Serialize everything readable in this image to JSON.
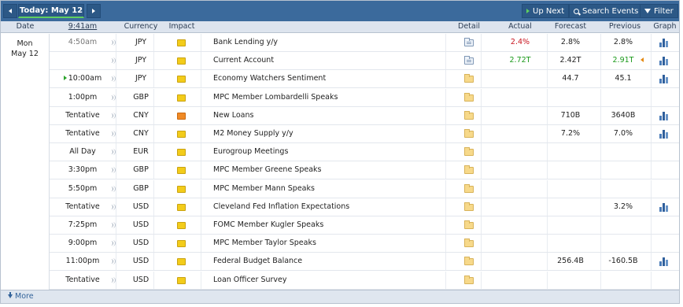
{
  "toolbar": {
    "today_label": "Today: May 12",
    "up_next_label": "Up Next",
    "search_label": "Search Events",
    "filter_label": "Filter"
  },
  "columns": {
    "date": "Date",
    "time": "9:41am",
    "currency": "Currency",
    "impact": "Impact",
    "detail": "Detail",
    "actual": "Actual",
    "forecast": "Forecast",
    "previous": "Previous",
    "graph": "Graph"
  },
  "date_cell": {
    "weekday": "Mon",
    "date": "May 12"
  },
  "events": [
    {
      "time": "4:50am",
      "currency": "JPY",
      "impact": "low",
      "event": "Bank Lending y/y",
      "detail_icon": "doc-folder-icon",
      "actual": "2.4%",
      "actual_color": "red",
      "forecast": "2.8%",
      "previous": "2.8%",
      "graph": true
    },
    {
      "time": "",
      "currency": "JPY",
      "impact": "low",
      "event": "Current Account",
      "detail_icon": "doc-folder-icon",
      "actual": "2.72T",
      "actual_color": "green",
      "forecast": "2.42T",
      "previous": "2.91T",
      "previous_color": "green",
      "revised": true,
      "graph": true
    },
    {
      "time": "10:00am",
      "upcoming": true,
      "currency": "JPY",
      "impact": "low",
      "event": "Economy Watchers Sentiment",
      "detail_icon": "folder-icon",
      "actual": "",
      "forecast": "44.7",
      "previous": "45.1",
      "graph": true
    },
    {
      "time": "1:00pm",
      "currency": "GBP",
      "impact": "low",
      "event": "MPC Member Lombardelli Speaks",
      "detail_icon": "folder-icon",
      "actual": "",
      "forecast": "",
      "previous": "",
      "graph": false
    },
    {
      "time": "Tentative",
      "currency": "CNY",
      "impact": "medium",
      "event": "New Loans",
      "detail_icon": "folder-icon",
      "actual": "",
      "forecast": "710B",
      "previous": "3640B",
      "graph": true
    },
    {
      "time": "Tentative",
      "currency": "CNY",
      "impact": "low",
      "event": "M2 Money Supply y/y",
      "detail_icon": "folder-icon",
      "actual": "",
      "forecast": "7.2%",
      "previous": "7.0%",
      "graph": true
    },
    {
      "time": "All Day",
      "currency": "EUR",
      "impact": "low",
      "event": "Eurogroup Meetings",
      "detail_icon": "folder-icon",
      "actual": "",
      "forecast": "",
      "previous": "",
      "graph": false
    },
    {
      "time": "3:30pm",
      "currency": "GBP",
      "impact": "low",
      "event": "MPC Member Greene Speaks",
      "detail_icon": "folder-icon",
      "actual": "",
      "forecast": "",
      "previous": "",
      "graph": false
    },
    {
      "time": "5:50pm",
      "currency": "GBP",
      "impact": "low",
      "event": "MPC Member Mann Speaks",
      "detail_icon": "folder-icon",
      "actual": "",
      "forecast": "",
      "previous": "",
      "graph": false
    },
    {
      "time": "Tentative",
      "currency": "USD",
      "impact": "low",
      "event": "Cleveland Fed Inflation Expectations",
      "detail_icon": "folder-icon",
      "actual": "",
      "forecast": "",
      "previous": "3.2%",
      "graph": true
    },
    {
      "time": "7:25pm",
      "currency": "USD",
      "impact": "low",
      "event": "FOMC Member Kugler Speaks",
      "detail_icon": "folder-icon",
      "actual": "",
      "forecast": "",
      "previous": "",
      "graph": false
    },
    {
      "time": "9:00pm",
      "currency": "USD",
      "impact": "low",
      "event": "MPC Member Taylor Speaks",
      "detail_icon": "folder-icon",
      "actual": "",
      "forecast": "",
      "previous": "",
      "graph": false
    },
    {
      "time": "11:00pm",
      "currency": "USD",
      "impact": "low",
      "event": "Federal Budget Balance",
      "detail_icon": "folder-icon",
      "actual": "",
      "forecast": "256.4B",
      "previous": "-160.5B",
      "graph": true
    },
    {
      "time": "Tentative",
      "currency": "USD",
      "impact": "low",
      "event": "Loan Officer Survey",
      "detail_icon": "folder-icon",
      "actual": "",
      "forecast": "",
      "previous": "",
      "graph": false
    }
  ],
  "footer": {
    "more_label": "More"
  },
  "colors": {
    "toolbar_bg": "#3b6a9c",
    "header_bg": "#dde4ee",
    "impact_low": "#f3cc1a",
    "impact_medium": "#f08a25",
    "actual_worse": "#c8141e",
    "actual_better": "#1b9a1b"
  }
}
